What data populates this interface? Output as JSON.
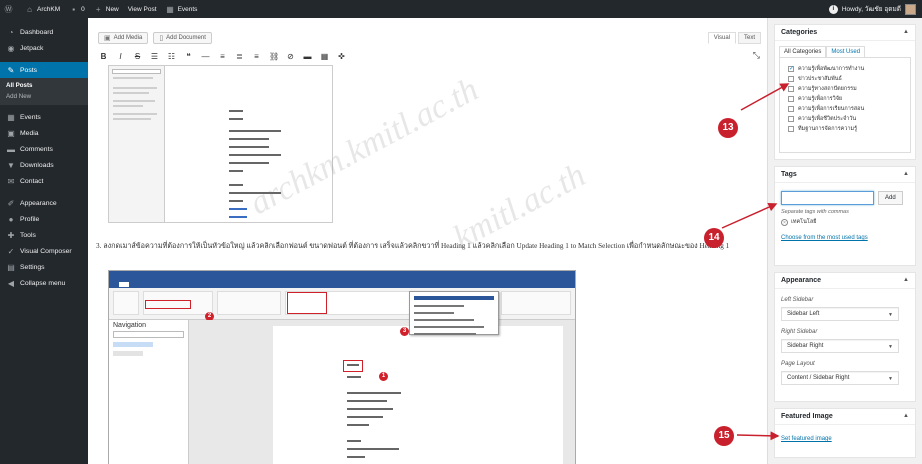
{
  "adminbar": {
    "site_name": "ArchKM",
    "comments_count": "0",
    "new_label": "New",
    "view_post_label": "View Post",
    "events_label": "Events",
    "howdy": "Howdy, วัฒชัย อุดมดี"
  },
  "sidebar": {
    "items": [
      {
        "label": "Dashboard",
        "icon": "dashboard-icon"
      },
      {
        "label": "Jetpack",
        "icon": "jetpack-icon"
      },
      {
        "label": "Posts",
        "icon": "pin-icon",
        "active": true
      },
      {
        "label": "Events",
        "icon": "calendar-icon"
      },
      {
        "label": "Media",
        "icon": "media-icon"
      },
      {
        "label": "Comments",
        "icon": "comment-icon"
      },
      {
        "label": "Downloads",
        "icon": "download-icon"
      },
      {
        "label": "Contact",
        "icon": "mail-icon"
      },
      {
        "label": "Appearance",
        "icon": "brush-icon"
      },
      {
        "label": "Profile",
        "icon": "user-icon"
      },
      {
        "label": "Tools",
        "icon": "wrench-icon"
      },
      {
        "label": "Visual Composer",
        "icon": "vc-icon"
      },
      {
        "label": "Settings",
        "icon": "settings-icon"
      },
      {
        "label": "Collapse menu",
        "icon": "collapse-icon"
      }
    ],
    "submenu": [
      "All Posts",
      "Add New"
    ]
  },
  "editor": {
    "add_media": "Add Media",
    "add_document": "Add Document",
    "tab_visual": "Visual",
    "tab_text": "Text",
    "paragraph": "3. ลงกดเมาส์ข้อความที่ต้องการให้เป็นหัวข้อใหญ่ แล้วคลิกเลือกฟอนต์ ขนาดฟอนต์ ที่ต้องการ เสร็จแล้วคลิกขวาที่ Heading 1 แล้วคลิกเลือก Update Heading 1 to Match Selection เพื่อกำหนดลักษณะของ Heading 1",
    "nav_pane_title": "Navigation",
    "step_badges": [
      "1",
      "2",
      "3"
    ]
  },
  "categories": {
    "title": "Categories",
    "tab_all": "All Categories",
    "tab_most": "Most Used",
    "items": [
      {
        "label": "ความรู้เพื่อพัฒนาการทำงาน",
        "checked": true
      },
      {
        "label": "ข่าวประชาสัมพันธ์",
        "checked": false
      },
      {
        "label": "ความรู้ทางสถาปัตยกรรม",
        "checked": false
      },
      {
        "label": "ความรู้เพื่อการวิจัย",
        "checked": false
      },
      {
        "label": "ความรู้เพื่อการเรียนการสอน",
        "checked": false
      },
      {
        "label": "ความรู้เพื่อชีวิตประจำวัน",
        "checked": false
      },
      {
        "label": "ทีมฐานการจัดการความรู้",
        "checked": false
      }
    ]
  },
  "tags": {
    "title": "Tags",
    "add_label": "Add",
    "hint": "Separate tags with commas",
    "chip": "เทคโนโลยี",
    "choose_link": "Choose from the most used tags"
  },
  "appearance": {
    "title": "Appearance",
    "left_sidebar_label": "Left Sidebar",
    "left_sidebar_value": "Sidebar Left",
    "right_sidebar_label": "Right Sidebar",
    "right_sidebar_value": "Sidebar Right",
    "page_layout_label": "Page Layout",
    "page_layout_value": "Content / Sidebar Right"
  },
  "featured_image": {
    "title": "Featured Image",
    "link": "Set featured image"
  },
  "callouts": [
    "13",
    "14",
    "15"
  ],
  "colors": {
    "accent": "#0073aa",
    "admin_dark": "#23282d",
    "callout_red": "#c8202d"
  }
}
